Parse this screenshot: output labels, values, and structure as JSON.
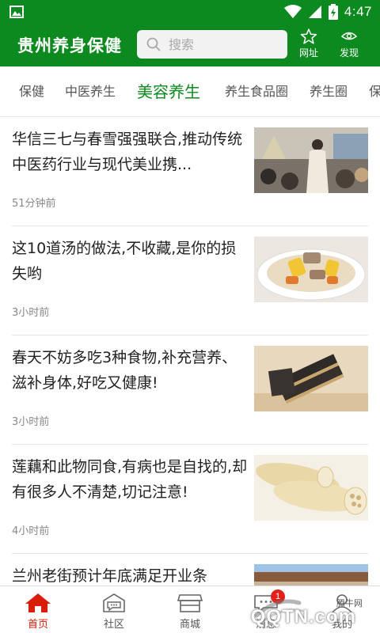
{
  "status_bar": {
    "time": "4:47"
  },
  "header": {
    "title": "贵州养身保健",
    "search_placeholder": "搜索",
    "web_label": "网址",
    "find_label": "发现"
  },
  "tabs": [
    {
      "label": "保健"
    },
    {
      "label": "中医养生"
    },
    {
      "label": "美容养生",
      "active": true
    },
    {
      "label": "养生食品圈"
    },
    {
      "label": "养生圈"
    },
    {
      "label": "保"
    }
  ],
  "articles": [
    {
      "title": "华信三七与春雪强强联合,推动传统中医药行业与现代美业携...",
      "time": "51分钟前",
      "image": "conference-photo"
    },
    {
      "title": "这10道汤的做法,不收藏,是你的损失哟",
      "time": "3小时前",
      "image": "soup-photo"
    },
    {
      "title": "春天不妨多吃3种食物,补充营养、滋补身体,好吃又健康!",
      "time": "3小时前",
      "image": "sesame-cake-photo"
    },
    {
      "title": "莲藕和此物同食,有病也是自找的,却有很多人不清楚,切记注意!",
      "time": "4小时前",
      "image": "lotus-root-photo"
    },
    {
      "title": "兰州老街预计年底满足开业条",
      "time": "",
      "image": "street-photo"
    }
  ],
  "bottom_nav": [
    {
      "label": "首页",
      "icon": "home-icon",
      "active": true
    },
    {
      "label": "社区",
      "icon": "community-icon"
    },
    {
      "label": "商城",
      "icon": "shop-icon"
    },
    {
      "label": "消息",
      "icon": "message-icon",
      "badge": "1"
    },
    {
      "label": "我的",
      "icon": "user-icon"
    }
  ],
  "watermark": {
    "brand": "腾牛网",
    "logo": "QQTN.com"
  },
  "colors": {
    "primary": "#0c8a1f",
    "nav_active": "#d81e06",
    "badge": "#e0221b"
  }
}
